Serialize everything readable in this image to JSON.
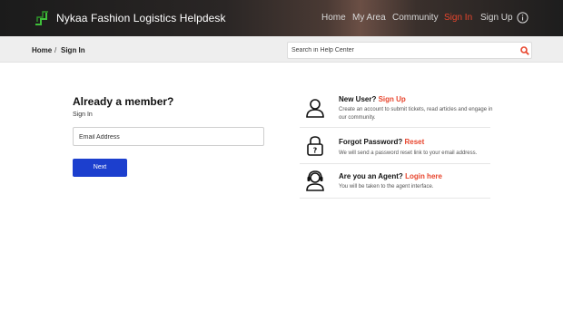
{
  "header": {
    "brand": "Nykaa Fashion Logistics Helpdesk",
    "nav": [
      "Home",
      "My Area",
      "Community",
      "Sign In",
      "Sign Up"
    ],
    "active_color": "#e8462e",
    "logo_icon": "logo-icon",
    "info_icon": "info-icon"
  },
  "breadcrumb": {
    "home": "Home",
    "sep": "/",
    "current": "Sign In"
  },
  "search": {
    "placeholder": "Search in Help Center",
    "icon": "search-icon"
  },
  "login": {
    "title": "Already a member?",
    "subtitle": "Sign In",
    "email_placeholder": "Email Address",
    "next_label": "Next",
    "button_color": "#1c3fce"
  },
  "options": [
    {
      "icon": "user-icon",
      "question": "New User?",
      "link": "Sign Up",
      "desc": "Create an account to submit tickets, read articles and engage in our community."
    },
    {
      "icon": "lock-icon",
      "question": "Forgot Password?",
      "link": "Reset",
      "desc": "We will send a password reset link to your email address."
    },
    {
      "icon": "agent-headset-icon",
      "question": "Are you an Agent?",
      "link": "Login here",
      "desc": "You will be taken to the agent interface."
    }
  ]
}
